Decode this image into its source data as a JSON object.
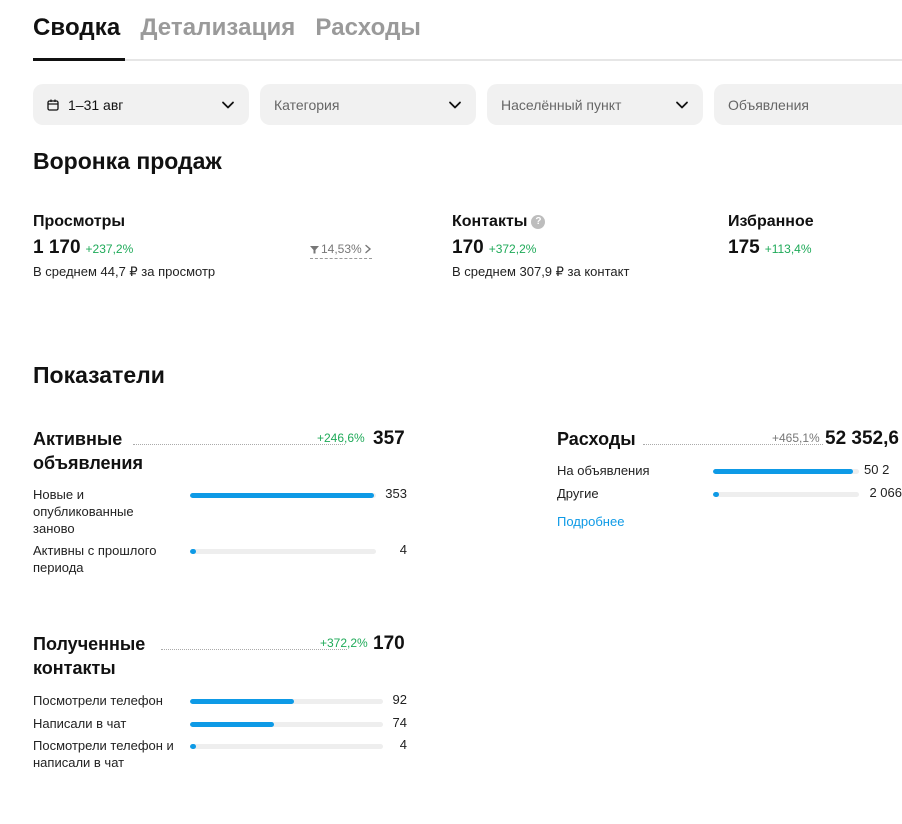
{
  "tabs": [
    {
      "label": "Сводка",
      "active": true
    },
    {
      "label": "Детализация",
      "active": false
    },
    {
      "label": "Расходы",
      "active": false
    }
  ],
  "filters": {
    "date": "1–31 авг",
    "category": "Категория",
    "locality": "Населённый пункт",
    "ads": "Объявления"
  },
  "funnel": {
    "title": "Воронка продаж",
    "views": {
      "label": "Просмотры",
      "value": "1 170",
      "change": "+237,2%",
      "avg": "В среднем 44,7 ₽ за просмотр"
    },
    "conversion": "14,53%",
    "contacts": {
      "label": "Контакты",
      "value": "170",
      "change": "+372,2%",
      "avg": "В среднем 307,9 ₽ за контакт"
    },
    "favorites": {
      "label": "Избранное",
      "value": "175",
      "change": "+113,4%"
    }
  },
  "indicators": {
    "title": "Показатели",
    "active_ads": {
      "title_line1": "Активные",
      "title_line2": "объявления",
      "change": "+246,6%",
      "value": "357",
      "rows": [
        {
          "label": "Новые и опубликованные заново",
          "value": "353",
          "fill": 0.989
        },
        {
          "label": "Активны с прошлого периода",
          "value": "4",
          "fill": 0.011
        }
      ]
    },
    "expenses": {
      "title": "Расходы",
      "change": "+465,1%",
      "value": "52 352,6",
      "rows": [
        {
          "label": "На объявления",
          "value": "50 2",
          "fill": 0.96
        },
        {
          "label": "Другие",
          "value": "2 066",
          "fill": 0.04
        }
      ],
      "more_link": "Подробнее"
    },
    "contacts": {
      "title_line1": "Полученные",
      "title_line2": "контакты",
      "change": "+372,2%",
      "value": "170",
      "rows": [
        {
          "label": "Посмотрели телефон",
          "value": "92",
          "fill": 0.541
        },
        {
          "label": "Написали в чат",
          "value": "74",
          "fill": 0.435
        },
        {
          "label": "Посмотрели телефон и написали в чат",
          "value": "4",
          "fill": 0.024
        }
      ]
    }
  },
  "colors": {
    "accent": "#0e9ae6",
    "positive": "#1faa59"
  },
  "icons": [
    "calendar-icon",
    "chevron-down-icon",
    "help-icon",
    "funnel-icon",
    "chevron-right-icon"
  ]
}
